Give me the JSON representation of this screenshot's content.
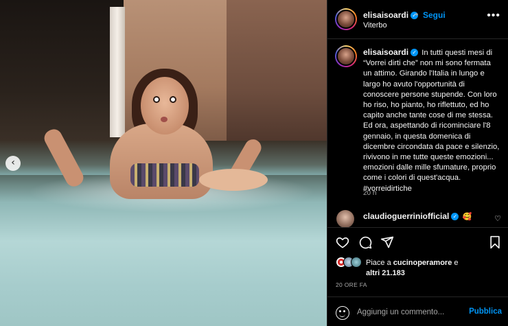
{
  "post": {
    "username": "elisaisoardi",
    "follow_label": "Segui",
    "separator": "•",
    "location": "Viterbo",
    "more": "•••"
  },
  "caption": {
    "username": "elisaisoardi",
    "text": "In tutti questi mesi di “Vorrei dirti che” non mi sono fermata un attimo. Girando l'Italia in lungo e largo ho avuto l'opportunità di conoscere persone stupende. Con loro ho riso, ho pianto, ho riflettuto, ed ho capito anche tante cose di me stessa. Ed ora, aspettando di ricominciare l'8 gennaio, in questa domenica di dicembre circondata da pace e silenzio, rivivono in me tutte queste emozioni... emozioni dalle mille sfumature, proprio come i colori di quest'acqua. #vorreidirtiche",
    "time": "20 h"
  },
  "comment": {
    "username": "claudioguerriniofficial",
    "emoji": "🥰"
  },
  "likes": {
    "prefix": "Piace a ",
    "user": "cucinoperamore",
    "middle": " e",
    "others": "altri 21.183"
  },
  "date": "20 ORE FA",
  "add_comment": {
    "placeholder": "Aggiungi un commento...",
    "publish_label": "Pubblica"
  },
  "icons": {
    "verified": "✓",
    "prev": "‹",
    "heart": "♡"
  },
  "colors": {
    "accent": "#0095f6",
    "background": "#000000",
    "text": "#f5f5f5",
    "muted": "#a8a8a8"
  }
}
